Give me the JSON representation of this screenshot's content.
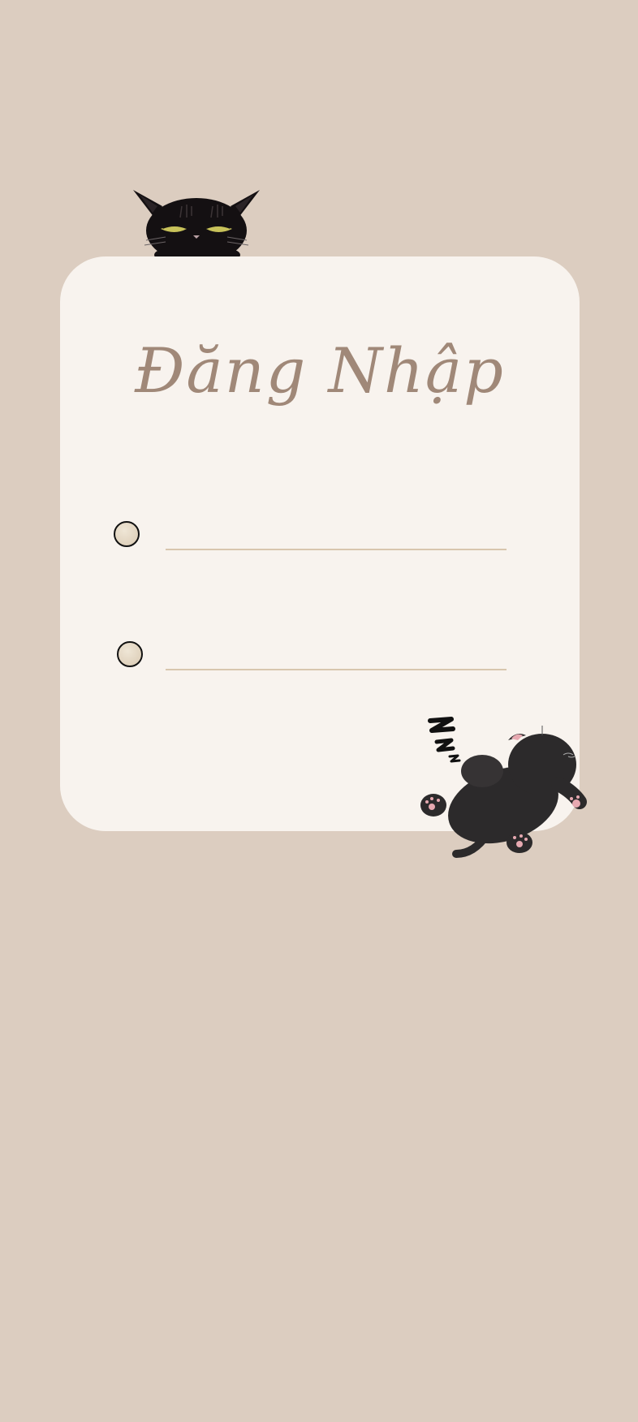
{
  "login": {
    "title": "Đăng Nhập",
    "username": {
      "value": "",
      "placeholder": "",
      "icon": "user-circle-icon"
    },
    "password": {
      "value": "",
      "placeholder": "",
      "icon": "lock-circle-icon"
    }
  },
  "decor": {
    "top_cat": "peeking-black-cat",
    "bottom_cat": "sleeping-black-cat",
    "zzz": "zzz"
  },
  "colors": {
    "background": "#dccdc0",
    "card": "#f8f3ee",
    "title": "#a08878",
    "underline": "#d8c6ae"
  }
}
